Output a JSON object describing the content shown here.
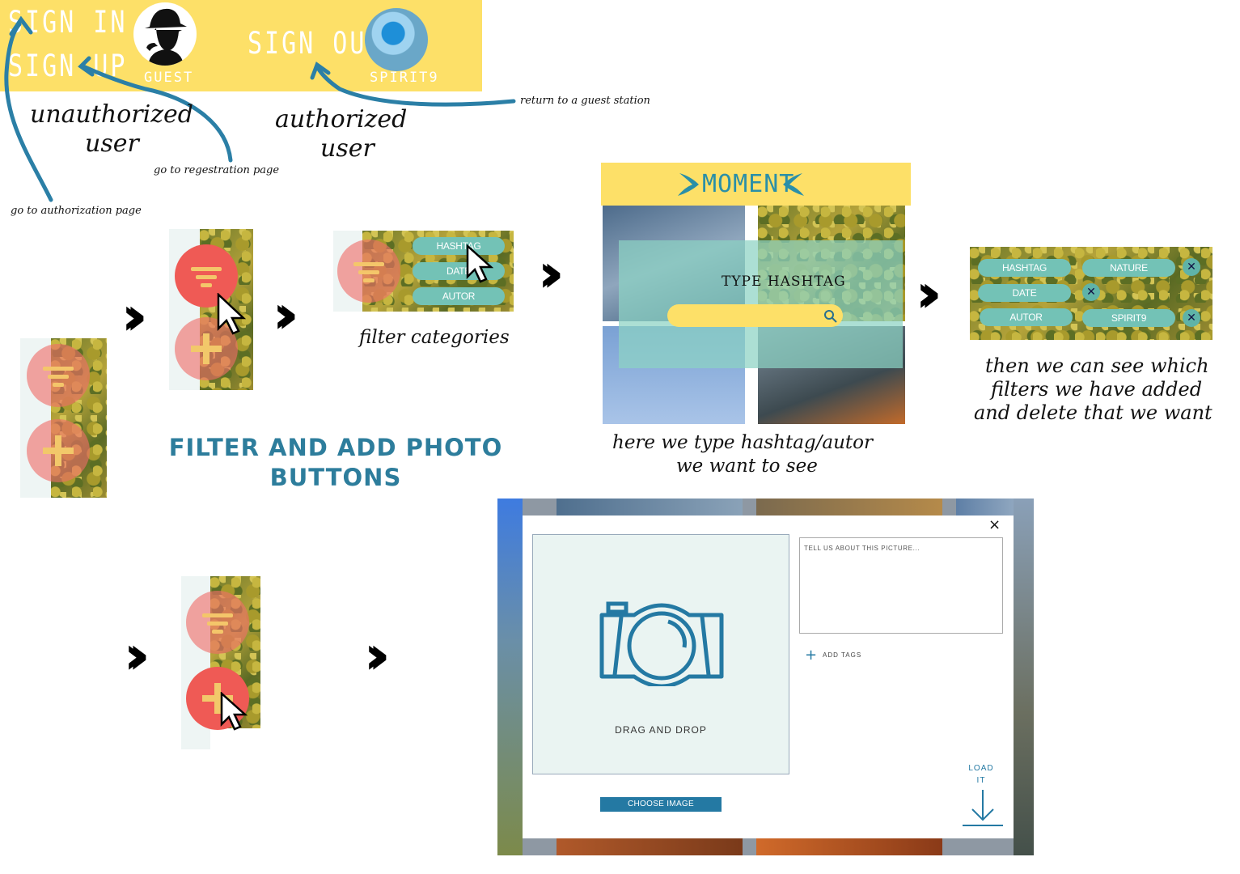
{
  "header": {
    "sign_in": "SIGN IN",
    "sign_up": "SIGN UP",
    "guest_label": "GUEST",
    "sign_out": "SIGN OUT",
    "user_label": "SPIRIT9"
  },
  "annotations": {
    "unauthorized_line1": "unauthorized",
    "unauthorized_line2": "user",
    "authorized_line1": "authorized",
    "authorized_line2": "user",
    "return_guest": "return to a guest station",
    "go_registration": "go to regestration page",
    "go_authorization": "go to authorization page",
    "filter_categories": "filter categories",
    "hashtag_line1": "here we type hashtag/autor",
    "hashtag_line2": "we want to see",
    "filters_line1": "then we can see which",
    "filters_line2": "filters we have added",
    "filters_line3": "and delete that we want"
  },
  "section_title": {
    "line1": "FILTER AND ADD PHOTO",
    "line2": "BUTTONS"
  },
  "filter_menu": {
    "hashtag": "HASHTAG",
    "date": "DATE",
    "autor": "AUTOR"
  },
  "moment": {
    "title": "MOMENT",
    "search_label": "TYPE HASHTAG"
  },
  "active_filters": {
    "hashtag": "HASHTAG",
    "date": "DATE",
    "autor": "AUTOR",
    "nature": "NATURE",
    "spirit9": "SPIRIT9"
  },
  "modal": {
    "drag_drop": "DRAG AND DROP",
    "textarea_placeholder": "TELL US ABOUT THIS PICTURE...",
    "add_tags": "ADD TAGS",
    "choose_image": "CHOOSE IMAGE",
    "load_it_line1": "LOAD",
    "load_it_line2": "IT",
    "close": "×"
  },
  "colors": {
    "header_yellow": "#fde068",
    "teal_pill": "#73c2b6",
    "button_red": "#ef5a55",
    "accent_blue": "#2479a3"
  }
}
